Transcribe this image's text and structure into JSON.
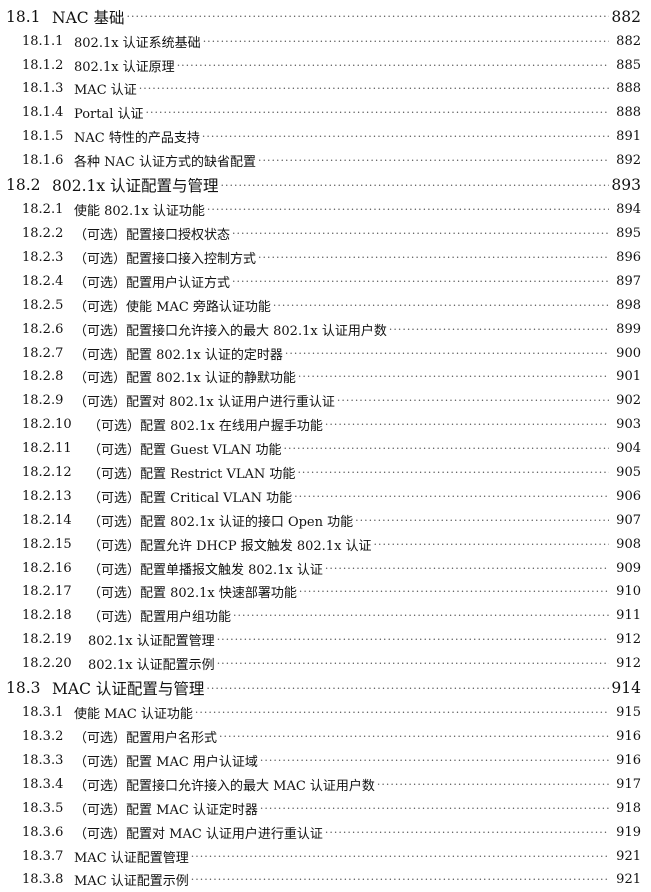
{
  "toc": [
    {
      "num": "18.1",
      "title": "NAC 基础",
      "page": "882",
      "level": 1
    },
    {
      "num": "18.1.1",
      "title": "802.1x 认证系统基础",
      "page": "882",
      "level": 2
    },
    {
      "num": "18.1.2",
      "title": "802.1x 认证原理",
      "page": "885",
      "level": 2
    },
    {
      "num": "18.1.3",
      "title": "MAC 认证",
      "page": "888",
      "level": 2
    },
    {
      "num": "18.1.4",
      "title": "Portal 认证",
      "page": "888",
      "level": 2
    },
    {
      "num": "18.1.5",
      "title": "NAC 特性的产品支持",
      "page": "891",
      "level": 2
    },
    {
      "num": "18.1.6",
      "title": "各种 NAC 认证方式的缺省配置",
      "page": "892",
      "level": 2
    },
    {
      "num": "18.2",
      "title": "802.1x 认证配置与管理",
      "page": "893",
      "level": 1
    },
    {
      "num": "18.2.1",
      "title": "使能 802.1x 认证功能",
      "page": "894",
      "level": 2
    },
    {
      "num": "18.2.2",
      "title": "（可选）配置接口授权状态",
      "page": "895",
      "level": 2
    },
    {
      "num": "18.2.3",
      "title": "（可选）配置接口接入控制方式",
      "page": "896",
      "level": 2
    },
    {
      "num": "18.2.4",
      "title": "（可选）配置用户认证方式",
      "page": "897",
      "level": 2
    },
    {
      "num": "18.2.5",
      "title": "（可选）使能 MAC 旁路认证功能",
      "page": "898",
      "level": 2
    },
    {
      "num": "18.2.6",
      "title": "（可选）配置接口允许接入的最大 802.1x 认证用户数",
      "page": "899",
      "level": 2
    },
    {
      "num": "18.2.7",
      "title": "（可选）配置 802.1x 认证的定时器",
      "page": "900",
      "level": 2
    },
    {
      "num": "18.2.8",
      "title": "（可选）配置 802.1x 认证的静默功能",
      "page": "901",
      "level": 2
    },
    {
      "num": "18.2.9",
      "title": "（可选）配置对 802.1x 认证用户进行重认证",
      "page": "902",
      "level": 2
    },
    {
      "num": "18.2.10",
      "title": "（可选）配置 802.1x 在线用户握手功能",
      "page": "903",
      "level": 2
    },
    {
      "num": "18.2.11",
      "title": "（可选）配置 Guest VLAN 功能",
      "page": "904",
      "level": 2
    },
    {
      "num": "18.2.12",
      "title": "（可选）配置 Restrict VLAN 功能",
      "page": "905",
      "level": 2
    },
    {
      "num": "18.2.13",
      "title": "（可选）配置 Critical VLAN 功能",
      "page": "906",
      "level": 2
    },
    {
      "num": "18.2.14",
      "title": "（可选）配置 802.1x 认证的接口 Open 功能",
      "page": "907",
      "level": 2
    },
    {
      "num": "18.2.15",
      "title": "（可选）配置允许 DHCP 报文触发 802.1x 认证",
      "page": "908",
      "level": 2
    },
    {
      "num": "18.2.16",
      "title": "（可选）配置单播报文触发 802.1x 认证",
      "page": "909",
      "level": 2
    },
    {
      "num": "18.2.17",
      "title": "（可选）配置 802.1x 快速部署功能",
      "page": "910",
      "level": 2
    },
    {
      "num": "18.2.18",
      "title": "（可选）配置用户组功能",
      "page": "911",
      "level": 2
    },
    {
      "num": "18.2.19",
      "title": "802.1x 认证配置管理",
      "page": "912",
      "level": 2
    },
    {
      "num": "18.2.20",
      "title": "802.1x 认证配置示例",
      "page": "912",
      "level": 2
    },
    {
      "num": "18.3",
      "title": "MAC 认证配置与管理",
      "page": "914",
      "level": 1
    },
    {
      "num": "18.3.1",
      "title": "使能 MAC 认证功能",
      "page": "915",
      "level": 2
    },
    {
      "num": "18.3.2",
      "title": "（可选）配置用户名形式",
      "page": "916",
      "level": 2
    },
    {
      "num": "18.3.3",
      "title": "（可选）配置 MAC 用户认证域",
      "page": "916",
      "level": 2
    },
    {
      "num": "18.3.4",
      "title": "（可选）配置接口允许接入的最大 MAC 认证用户数",
      "page": "917",
      "level": 2
    },
    {
      "num": "18.3.5",
      "title": "（可选）配置 MAC 认证定时器",
      "page": "918",
      "level": 2
    },
    {
      "num": "18.3.6",
      "title": "（可选）配置对 MAC 认证用户进行重认证",
      "page": "919",
      "level": 2
    },
    {
      "num": "18.3.7",
      "title": "MAC 认证配置管理",
      "page": "921",
      "level": 2
    },
    {
      "num": "18.3.8",
      "title": "MAC 认证配置示例",
      "page": "921",
      "level": 2
    }
  ]
}
